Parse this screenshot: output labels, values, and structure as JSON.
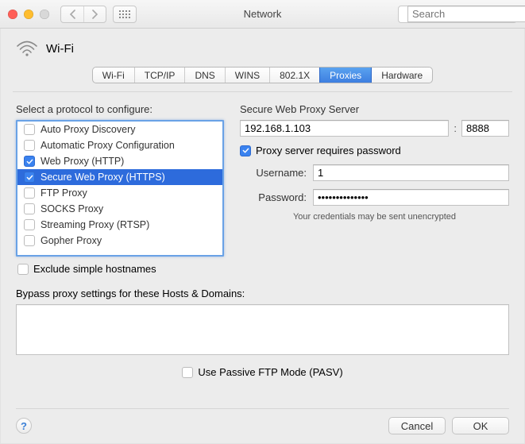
{
  "titlebar": {
    "title": "Network",
    "search_placeholder": "Search"
  },
  "header": {
    "interface": "Wi-Fi"
  },
  "tabs": [
    {
      "label": "Wi-Fi",
      "active": false
    },
    {
      "label": "TCP/IP",
      "active": false
    },
    {
      "label": "DNS",
      "active": false
    },
    {
      "label": "WINS",
      "active": false
    },
    {
      "label": "802.1X",
      "active": false
    },
    {
      "label": "Proxies",
      "active": true
    },
    {
      "label": "Hardware",
      "active": false
    }
  ],
  "left": {
    "label": "Select a protocol to configure:",
    "exclude_label": "Exclude simple hostnames",
    "exclude_checked": false
  },
  "protocols": [
    {
      "label": "Auto Proxy Discovery",
      "checked": false,
      "selected": false
    },
    {
      "label": "Automatic Proxy Configuration",
      "checked": false,
      "selected": false
    },
    {
      "label": "Web Proxy (HTTP)",
      "checked": true,
      "selected": false
    },
    {
      "label": "Secure Web Proxy (HTTPS)",
      "checked": true,
      "selected": true
    },
    {
      "label": "FTP Proxy",
      "checked": false,
      "selected": false
    },
    {
      "label": "SOCKS Proxy",
      "checked": false,
      "selected": false
    },
    {
      "label": "Streaming Proxy (RTSP)",
      "checked": false,
      "selected": false
    },
    {
      "label": "Gopher Proxy",
      "checked": false,
      "selected": false
    }
  ],
  "right": {
    "server_label": "Secure Web Proxy Server",
    "server_value": "192.168.1.103",
    "port_value": "8888",
    "requires_password_label": "Proxy server requires password",
    "requires_password_checked": true,
    "username_label": "Username:",
    "username_value": "1",
    "password_label": "Password:",
    "password_value": "••••••••••••••",
    "warn_text": "Your credentials may be sent unencrypted"
  },
  "bypass": {
    "label": "Bypass proxy settings for these Hosts & Domains:",
    "value": ""
  },
  "pasv": {
    "label": "Use Passive FTP Mode (PASV)",
    "checked": false
  },
  "footer": {
    "cancel": "Cancel",
    "ok": "OK"
  }
}
